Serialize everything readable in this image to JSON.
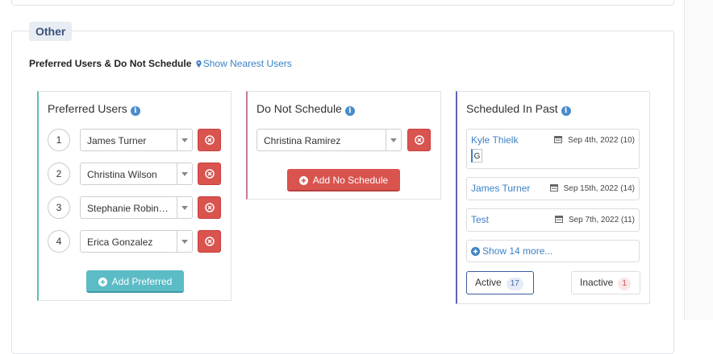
{
  "section": {
    "legend": "Other",
    "heading": "Preferred Users & Do Not Schedule",
    "nearest_link": "Show Nearest Users"
  },
  "preferred": {
    "title": "Preferred Users",
    "items": [
      {
        "number": "1",
        "name": "James Turner"
      },
      {
        "number": "2",
        "name": "Christina Wilson"
      },
      {
        "number": "3",
        "name": "Stephanie Robinson"
      },
      {
        "number": "4",
        "name": "Erica Gonzalez"
      }
    ],
    "add_label": "Add Preferred"
  },
  "do_not_schedule": {
    "title": "Do Not Schedule",
    "items": [
      {
        "name": "Christina Ramirez"
      }
    ],
    "add_label": "Add No Schedule"
  },
  "scheduled_past": {
    "title": "Scheduled In Past",
    "items": [
      {
        "name": "Kyle Thielk",
        "date": "Sep 4th, 2022 (10)",
        "tag": "G"
      },
      {
        "name": "James Turner",
        "date": "Sep 15th, 2022 (14)"
      },
      {
        "name": "Test",
        "date": "Sep 7th, 2022 (11)"
      }
    ],
    "show_more": "Show 14 more...",
    "filters": {
      "active_label": "Active",
      "active_count": "17",
      "inactive_label": "Inactive",
      "inactive_count": "1"
    }
  },
  "colors": {
    "link": "#3c82c4",
    "danger": "#d9534f",
    "teal": "#5bbcc6",
    "preferred_accent": "#5cc0b0",
    "do_not_accent": "#c67a9e",
    "past_accent": "#5b67b8"
  },
  "icons": [
    "map-pin-icon",
    "info-icon",
    "chevron-down-icon",
    "remove-circle-icon",
    "plus-circle-icon",
    "calendar-icon"
  ]
}
